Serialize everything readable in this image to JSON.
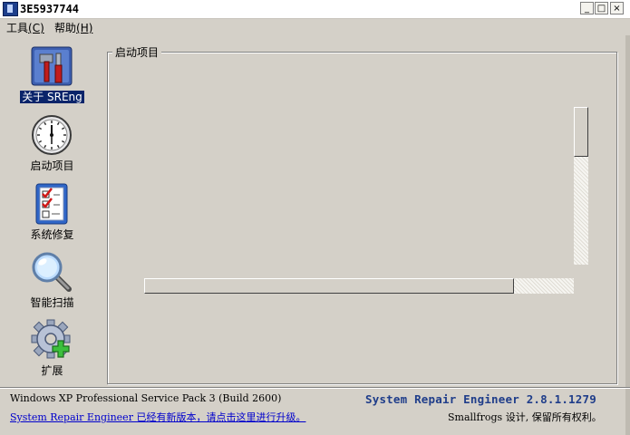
{
  "window": {
    "title": "3E5937744",
    "controls": {
      "minimize": "_",
      "maximize": "□",
      "close": "×"
    }
  },
  "menu": [
    {
      "label": "工具",
      "mnemonic": "(C)"
    },
    {
      "label": "帮助",
      "mnemonic": "(H)"
    }
  ],
  "sidebar": {
    "items": [
      {
        "label": "关于 SREng",
        "icon": "tools-icon",
        "active": true
      },
      {
        "label": "启动项目",
        "icon": "clock-icon",
        "active": false
      },
      {
        "label": "系统修复",
        "icon": "checklist-icon",
        "active": false
      },
      {
        "label": "智能扫描",
        "icon": "magnifier-icon",
        "active": false
      },
      {
        "label": "扩展",
        "icon": "gear-plus-icon",
        "active": false
      }
    ]
  },
  "main": {
    "group_label": "启动项目"
  },
  "footer": {
    "os_info": "Windows XP Professional Service Pack 3 (Build 2600)",
    "update_link": "System Repair Engineer 已经有新版本，请点击这里进行升级。",
    "product": "System Repair Engineer 2.8.1.1279",
    "copyright": "Smallfrogs 设计, 保留所有权利。"
  },
  "colors": {
    "face": "#d4d0c8",
    "selection": "#0a246a",
    "link": "#0000cc",
    "product": "#1f3d8a"
  }
}
